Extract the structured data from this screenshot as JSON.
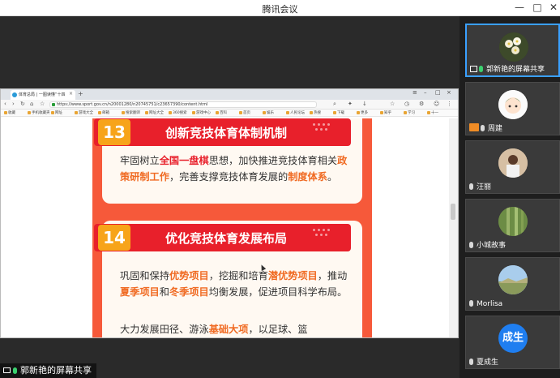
{
  "app": {
    "title": "腾讯会议"
  },
  "browser": {
    "tab_title": "体育总局 | 一图读懂“十四",
    "url": "https://www.sport.gov.cn/n20001280/n20745751/c23657390/content.html",
    "bookmarks": [
      "收藏",
      "手机收藏夹",
      "网址",
      "游戏大全",
      "邮箱",
      "搜索翻译",
      "网址大全",
      "360搜索",
      "游戏中心",
      "百科",
      "首页",
      "娱乐",
      "人民论坛",
      "热搜",
      "下载",
      "更多",
      "知乎",
      "学习",
      "十一"
    ]
  },
  "webpage": {
    "section13": {
      "number": "13",
      "title": "创新竞技体育体制机制",
      "paragraph": [
        "牢固树立",
        "全国一盘棋",
        "思想，加快推进竞技体育相关",
        "政策研制工作",
        "，完善支撑竞技体育发展的",
        "制度体系",
        "。"
      ]
    },
    "section14": {
      "number": "14",
      "title": "优化竞技体育发展布局",
      "paragraph1": [
        "巩固和保持",
        "优势项目",
        "，挖掘和培育",
        "潜优势项目",
        "，推动",
        "夏季项目",
        "和",
        "冬季项目",
        "均衡发展，促进项目科学布局。"
      ],
      "paragraph2": [
        "大力发展田径、游泳",
        "基础大项",
        "，以足球、篮"
      ]
    }
  },
  "share_indicator": {
    "label": "郭新艳的屏幕共享"
  },
  "participants": [
    {
      "name": "郭新艳的屏幕共享",
      "type": "screen-share",
      "active": true
    },
    {
      "name": "周建",
      "type": "host"
    },
    {
      "name": "汪丽",
      "type": "user"
    },
    {
      "name": "小城故事",
      "type": "user"
    },
    {
      "name": "Morlisa",
      "type": "user"
    },
    {
      "name": "夏成生",
      "type": "user",
      "avatar_text": "成生"
    }
  ],
  "colors": {
    "accent": "#3aa0ff",
    "panel": "#f6593a",
    "banner": "#e8202b",
    "number_tag": "#f7a41a",
    "mic_on": "#3bd16f"
  }
}
